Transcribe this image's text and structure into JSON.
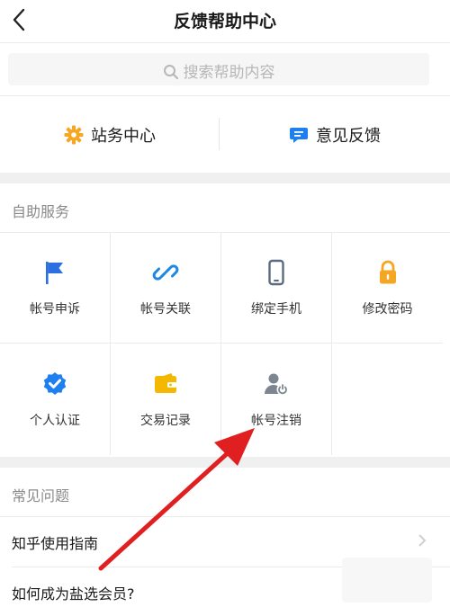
{
  "header": {
    "title": "反馈帮助中心",
    "back_icon": "chevron-left-icon"
  },
  "search": {
    "placeholder": "搜索帮助内容",
    "icon": "search-icon"
  },
  "quick_actions": [
    {
      "label": "站务中心",
      "icon": "gear-icon",
      "color": "#f5a623"
    },
    {
      "label": "意见反馈",
      "icon": "chat-bubble-icon",
      "color": "#1e7ff0"
    }
  ],
  "self_service": {
    "title": "自助服务",
    "items": [
      {
        "label": "帐号申诉",
        "icon": "flag-icon",
        "color": "#2b6fe0"
      },
      {
        "label": "帐号关联",
        "icon": "link-icon",
        "color": "#1e88e5"
      },
      {
        "label": "绑定手机",
        "icon": "phone-icon",
        "color": "#5a6b80"
      },
      {
        "label": "修改密码",
        "icon": "lock-icon",
        "color": "#f5a623"
      },
      {
        "label": "个人认证",
        "icon": "verified-badge-icon",
        "color": "#1e7ff0"
      },
      {
        "label": "交易记录",
        "icon": "wallet-icon",
        "color": "#f5b800"
      },
      {
        "label": "帐号注销",
        "icon": "user-power-icon",
        "color": "#7c8590"
      }
    ]
  },
  "faq": {
    "title": "常见问题",
    "items": [
      {
        "label": "知乎使用指南"
      },
      {
        "label": "如何成为盐选会员?"
      }
    ]
  },
  "annotation": {
    "type": "red-arrow",
    "color": "#e02020",
    "target": "帐号注销"
  }
}
